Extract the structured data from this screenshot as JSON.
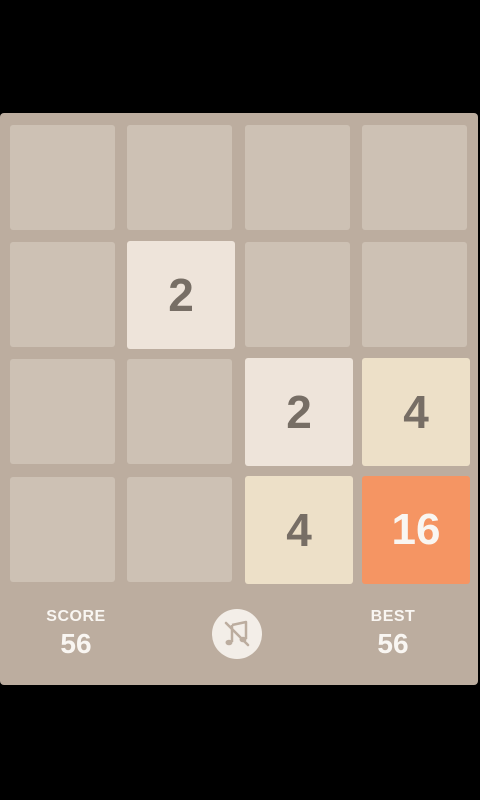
{
  "colors": {
    "background": "#000000",
    "panel": "#bcad9f",
    "empty_cell": "#cdc1b4",
    "tile_2": "#eee4da",
    "tile_4": "#ede0c8",
    "tile_16": "#f59563",
    "dark_text": "#776e65",
    "light_text": "#f9f6f2"
  },
  "board": {
    "size": 4,
    "tiles": [
      {
        "row": 1,
        "col": 1,
        "value": "2"
      },
      {
        "row": 2,
        "col": 2,
        "value": "2"
      },
      {
        "row": 2,
        "col": 3,
        "value": "4"
      },
      {
        "row": 3,
        "col": 2,
        "value": "4"
      },
      {
        "row": 3,
        "col": 3,
        "value": "16"
      }
    ]
  },
  "score": {
    "label": "SCORE",
    "value": "56"
  },
  "best": {
    "label": "BEST",
    "value": "56"
  },
  "music_toggle": {
    "icon": "music-off-icon"
  }
}
